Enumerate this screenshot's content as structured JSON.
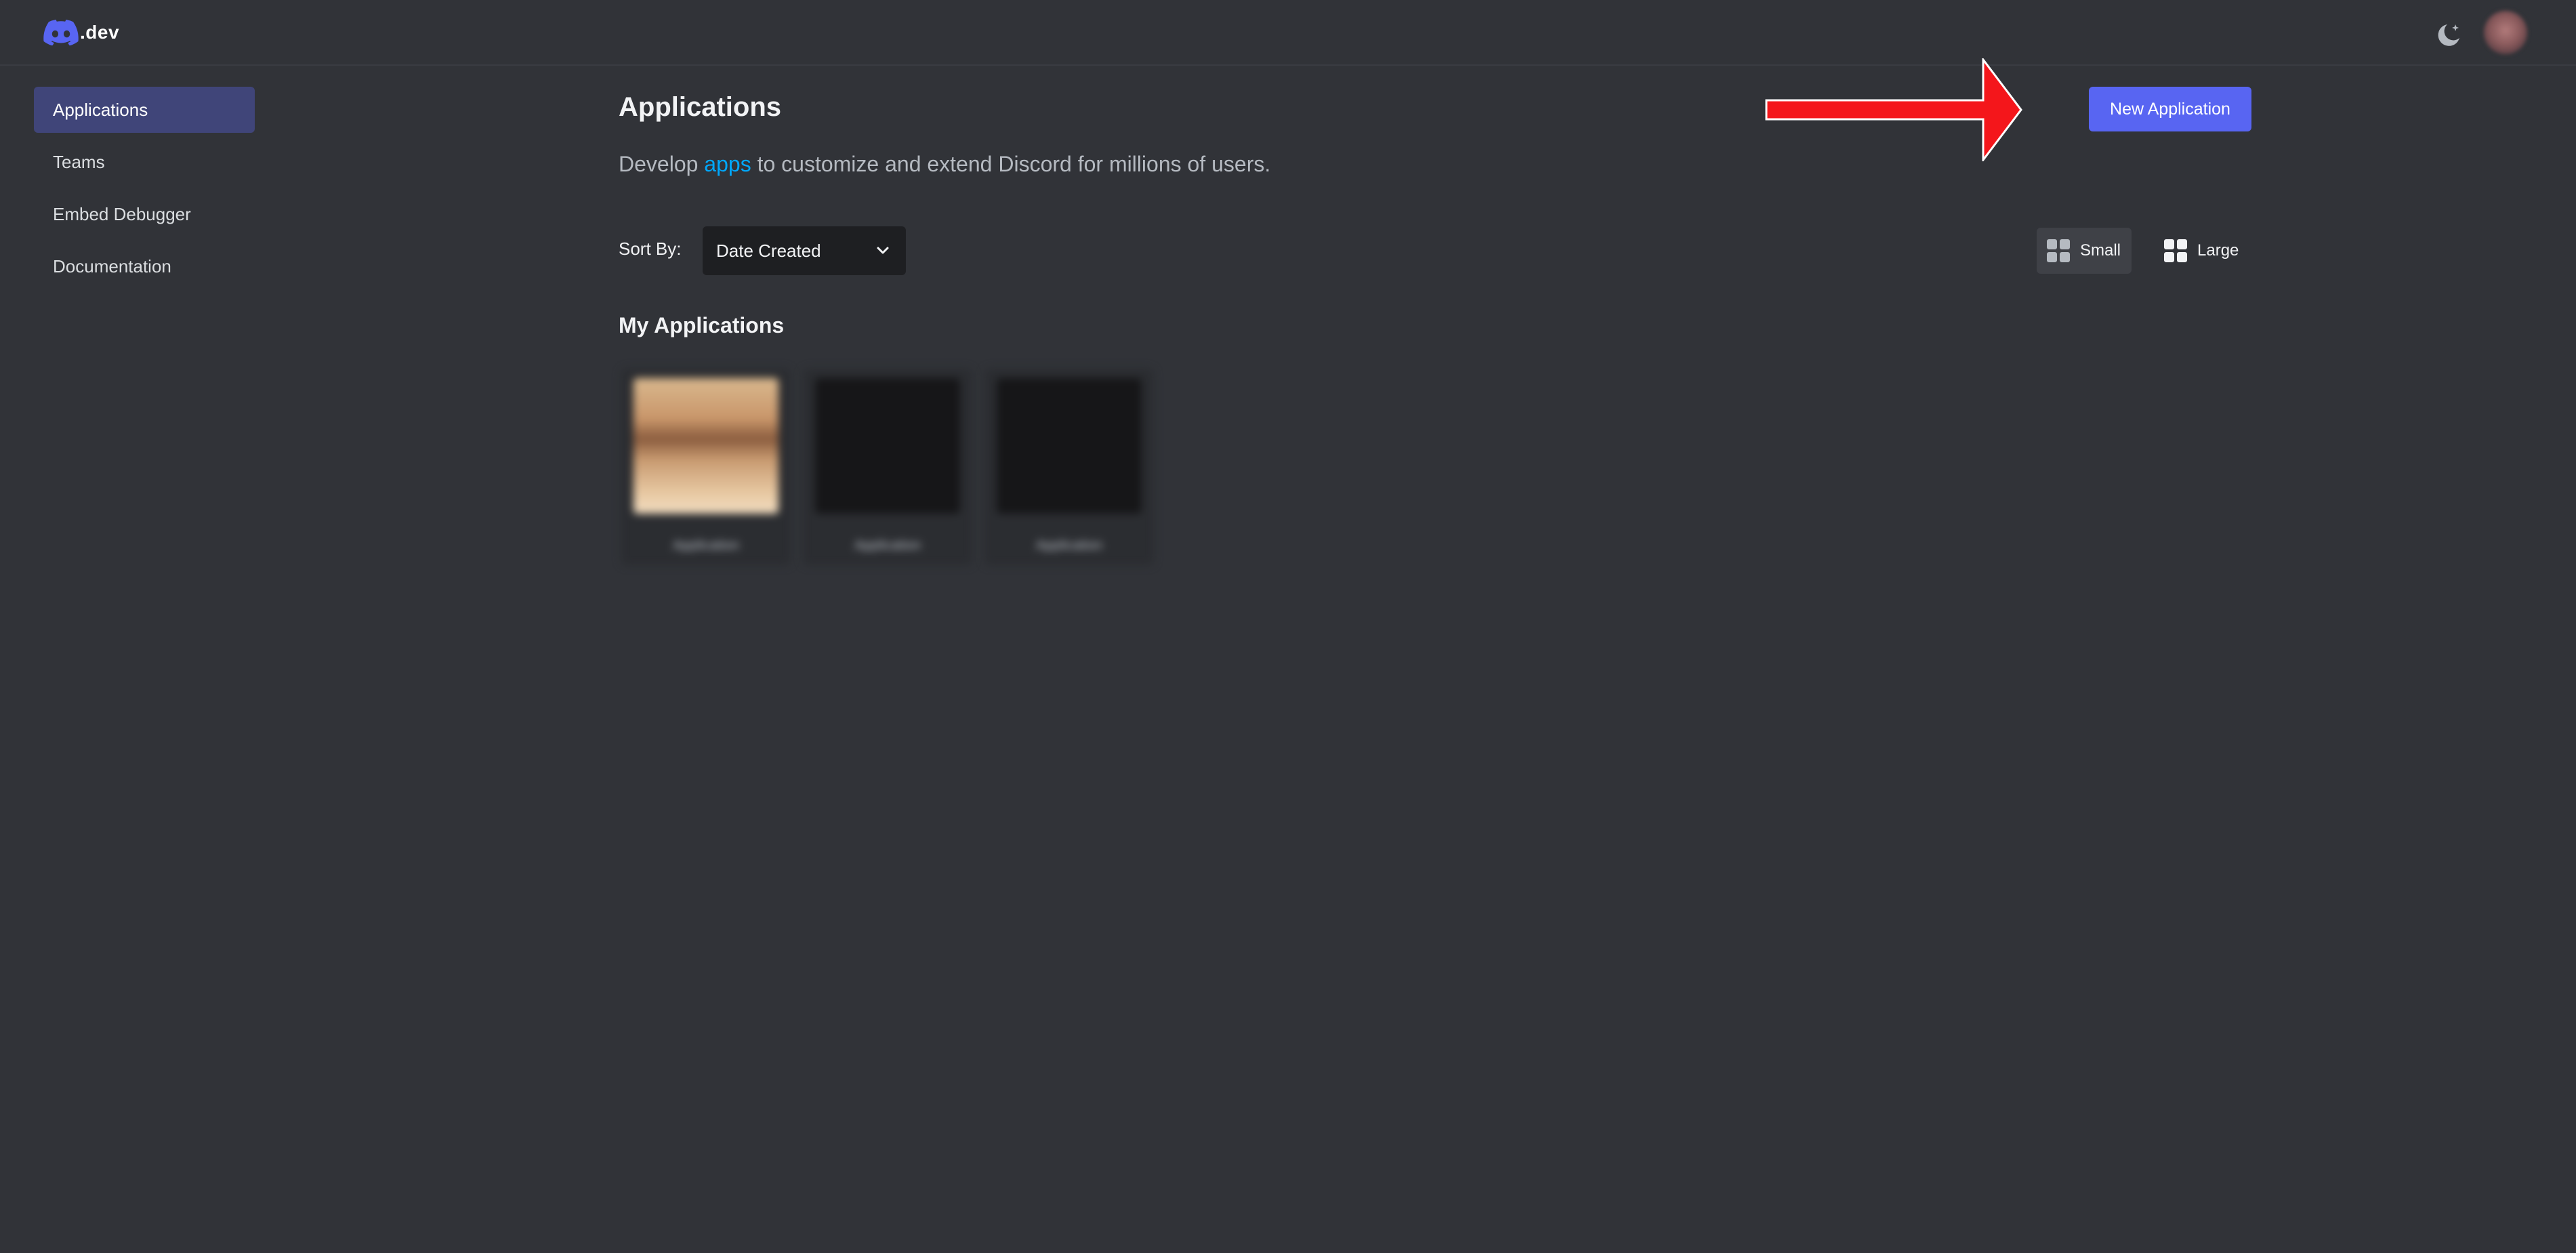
{
  "header": {
    "logo_text": ".dev",
    "theme_toggle_icon": "moon-sparkle-icon",
    "accent_color": "#5865f2"
  },
  "sidebar": {
    "items": [
      {
        "label": "Applications",
        "active": true
      },
      {
        "label": "Teams",
        "active": false
      },
      {
        "label": "Embed Debugger",
        "active": false
      },
      {
        "label": "Documentation",
        "active": false
      }
    ]
  },
  "main": {
    "title": "Applications",
    "subtitle_before": "Develop ",
    "subtitle_link": "apps",
    "subtitle_after": " to customize and extend Discord for millions of users.",
    "new_app_label": "New Application",
    "sort_label": "Sort By:",
    "sort_value": "Date Created",
    "size_small_label": "Small",
    "size_large_label": "Large",
    "section_title": "My Applications",
    "applications": [
      {
        "name": "Application",
        "has_image": true
      },
      {
        "name": "Application",
        "has_image": false
      },
      {
        "name": "Application",
        "has_image": false
      }
    ]
  }
}
